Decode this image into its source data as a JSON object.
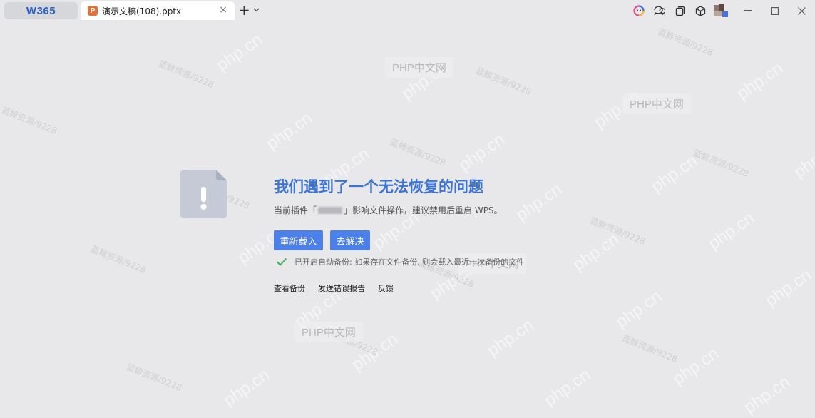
{
  "titlebar": {
    "home_tab_label": "W365",
    "document_tab": {
      "icon_letter": "P",
      "title": "演示文稿(108).pptx",
      "close_glyph": "×"
    },
    "new_tab_glyph": "+",
    "new_tab_menu_glyph": "⌄",
    "right_icons": [
      "colorful-circle-icon",
      "chat-icon",
      "copy-window-icon",
      "cube-icon",
      "avatar"
    ],
    "window_controls": [
      "minimize",
      "maximize",
      "close"
    ]
  },
  "error": {
    "title": "我们遇到了一个无法恢复的问题",
    "description_prefix": "当前插件「",
    "description_suffix": "」影响文件操作，建议禁用后重启 WPS。",
    "reload_button": "重新载入",
    "solve_button": "去解决",
    "backup_note": "已开启自动备份: 如果存在文件备份, 则会载入最近一次备份的文件",
    "links": {
      "view_backup": "查看备份",
      "send_report": "发送错误报告",
      "feedback": "反馈"
    }
  },
  "watermarks": {
    "php_label": "PHP中文网",
    "diagonal_label": "php.cn",
    "small_label": "蓝鲸资源/9228"
  },
  "colors": {
    "accent_blue": "#4a80e8",
    "title_blue": "#3c74d6",
    "check_green": "#3db35a",
    "background": "#e8e8ea"
  }
}
